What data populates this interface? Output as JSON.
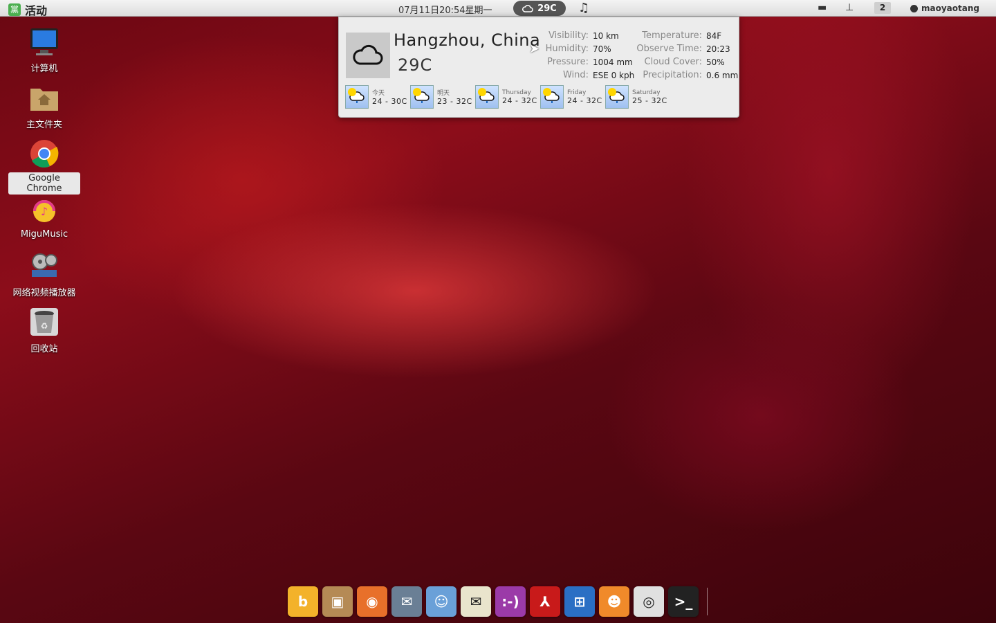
{
  "topbar": {
    "activities_logo": "黨",
    "activities_label": "活动",
    "clock": "07月11日20:54星期一",
    "weather_temp": "29C",
    "workspace": "2",
    "user": "maoyaotang"
  },
  "weather": {
    "city": "Hangzhou, China",
    "temp": "29C",
    "left_labels": [
      "Visibility:",
      "Humidity:",
      "Pressure:",
      "Wind:"
    ],
    "left_values": [
      "10 km",
      "70%",
      "1004 mm",
      "ESE 0 kph"
    ],
    "right_labels": [
      "Temperature:",
      "Observe Time:",
      "Cloud Cover:",
      "Precipitation:"
    ],
    "right_values": [
      "84F",
      "20:23",
      "50%",
      "0.6 mm"
    ],
    "forecast": [
      {
        "day": "今天",
        "range": "24 - 30C"
      },
      {
        "day": "明天",
        "range": "23 - 32C"
      },
      {
        "day": "Thursday",
        "range": "24 - 32C"
      },
      {
        "day": "Friday",
        "range": "24 - 32C"
      },
      {
        "day": "Saturday",
        "range": "25 - 32C"
      }
    ]
  },
  "desktop": {
    "icons": [
      {
        "label": "计算机"
      },
      {
        "label": "主文件夹"
      },
      {
        "label": "Google Chrome"
      },
      {
        "label": "MiguMusic"
      },
      {
        "label": "网络视频播放器"
      },
      {
        "label": "回收站"
      }
    ]
  },
  "dock": {
    "items": [
      {
        "icon": "baidu-b-icon",
        "glyph": "b",
        "color": "#f3b22a"
      },
      {
        "icon": "package-installer-icon",
        "glyph": "▣",
        "color": "#b58a55"
      },
      {
        "icon": "firefox-icon",
        "glyph": "◉",
        "color": "#e8702a"
      },
      {
        "icon": "mail-client-icon",
        "glyph": "✉",
        "color": "#6a7f95"
      },
      {
        "icon": "messenger-icon",
        "glyph": "☺",
        "color": "#6aa0d8"
      },
      {
        "icon": "qq-icon",
        "glyph": "✉",
        "color": "#e9e4cc"
      },
      {
        "icon": "feixin-icon",
        "glyph": ":-)",
        "color": "#9b3aa8"
      },
      {
        "icon": "pdf-reader-icon",
        "glyph": "⅄",
        "color": "#c81a1a"
      },
      {
        "icon": "cross-platform-icon",
        "glyph": "⊞",
        "color": "#2a6fc4"
      },
      {
        "icon": "pidgin-icon",
        "glyph": "☻",
        "color": "#f08a2a"
      },
      {
        "icon": "chrome-icon",
        "glyph": "◎",
        "color": "#e0e0e0"
      },
      {
        "icon": "terminal-icon",
        "glyph": ">_",
        "color": "#222222"
      }
    ]
  }
}
